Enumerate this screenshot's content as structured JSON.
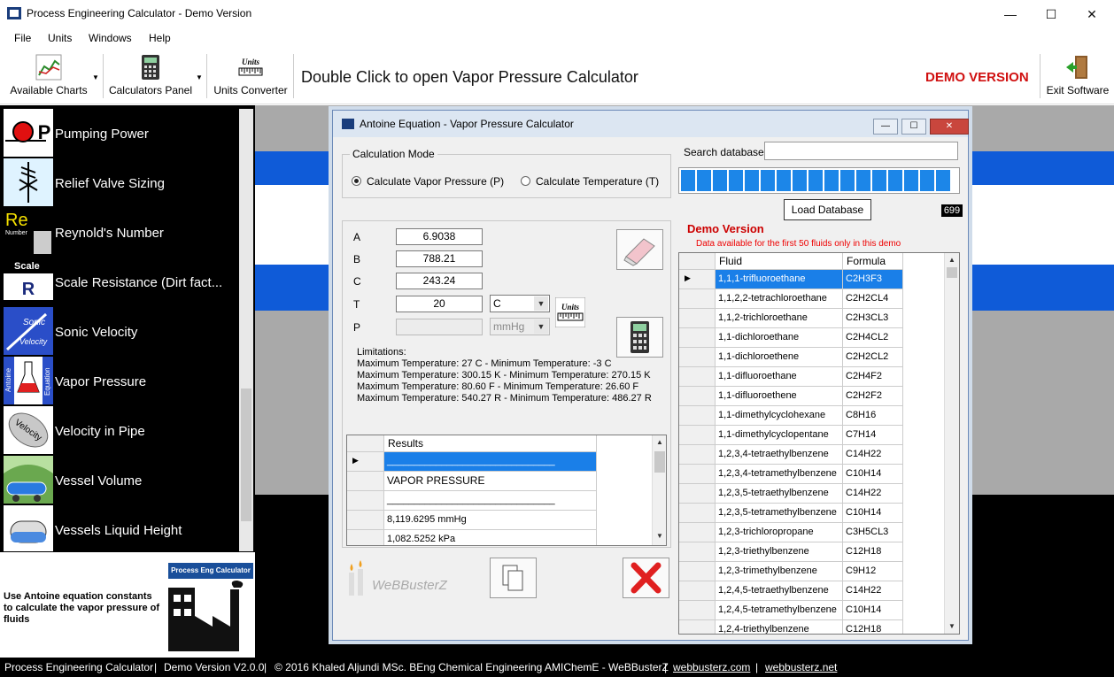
{
  "window": {
    "title": "Process Engineering Calculator - Demo Version",
    "minimize_glyph": "—",
    "maximize_glyph": "☐",
    "close_glyph": "✕"
  },
  "menu": [
    "File",
    "Units",
    "Windows",
    "Help"
  ],
  "toolbar": {
    "available_charts": "Available Charts",
    "calculators_panel": "Calculators Panel",
    "units_converter": "Units Converter",
    "units_icon_text": "Units",
    "hint": "Double Click to open Vapor Pressure Calculator",
    "demo": "DEMO VERSION",
    "exit": "Exit Software"
  },
  "sidebar": {
    "items": [
      {
        "label": "Pumping Power",
        "icon": "pump-icon",
        "thumb_text": "P"
      },
      {
        "label": "Relief Valve Sizing",
        "icon": "relief-valve-icon",
        "thumb_text": ""
      },
      {
        "label": "Reynold's Number",
        "icon": "reynolds-icon",
        "thumb_text": "Re",
        "thumb_sub": "Number"
      },
      {
        "label": "Scale Resistance (Dirt fact...",
        "icon": "scale-icon",
        "thumb_text": "Scale",
        "thumb_sub": "R"
      },
      {
        "label": "Sonic Velocity",
        "icon": "sonic-velocity-icon",
        "thumb_text": "Sonic",
        "thumb_sub": "Velocity"
      },
      {
        "label": "Vapor Pressure",
        "icon": "flask-icon",
        "thumb_text": "Antoine",
        "thumb_sub": "Equation"
      },
      {
        "label": "Velocity in Pipe",
        "icon": "velocity-icon",
        "thumb_text": "Velocity"
      },
      {
        "label": "Vessel Volume",
        "icon": "vessel-volume-icon",
        "thumb_text": ""
      },
      {
        "label": "Vessels Liquid Height",
        "icon": "vessel-height-icon",
        "thumb_text": ""
      }
    ],
    "description": "Use Antoine equation constants to calculate the vapor pressure of fluids",
    "logo_text": "Process Eng Calculator"
  },
  "dialog": {
    "title": "Antoine Equation - Vapor Pressure Calculator",
    "calc_mode": {
      "title": "Calculation Mode",
      "opt_p": "Calculate Vapor Pressure (P)",
      "opt_t": "Calculate Temperature (T)"
    },
    "inputs": {
      "a_label": "A",
      "a_value": "6.9038",
      "b_label": "B",
      "b_value": "788.21",
      "c_label": "C",
      "c_value": "243.24",
      "t_label": "T",
      "t_value": "20",
      "t_unit": "C",
      "p_label": "P",
      "p_value": "",
      "p_unit": "mmHg"
    },
    "limitations": [
      "Limitations:",
      "Maximum Temperature: 27 C - Minimum Temperature: -3 C",
      "Maximum Temperature: 300.15 K - Minimum Temperature: 270.15 K",
      "Maximum Temperature: 80.60 F - Minimum Temperature: 26.60 F",
      "Maximum Temperature: 540.27 R - Minimum Temperature: 486.27 R"
    ],
    "results": {
      "header": "Results",
      "rows": [
        "_______________________________",
        "VAPOR PRESSURE",
        "_______________________________",
        "8,119.6295 mmHg",
        "1,082.5252 kPa"
      ]
    },
    "brand": "WeBBusterZ",
    "search_label": "Search database",
    "load_db": "Load Database",
    "db_count": "699",
    "demo_version": "Demo Version",
    "demo_note": "Data available for the first 50 fluids only in this demo",
    "fluid_table": {
      "headers": [
        "Fluid",
        "Formula"
      ],
      "rows": [
        [
          "1,1,1-trifluoroethane",
          "C2H3F3"
        ],
        [
          "1,1,2,2-tetrachloroethane",
          "C2H2CL4"
        ],
        [
          "1,1,2-trichloroethane",
          "C2H3CL3"
        ],
        [
          "1,1-dichloroethane",
          "C2H4CL2"
        ],
        [
          "1,1-dichloroethene",
          "C2H2CL2"
        ],
        [
          "1,1-difluoroethane",
          "C2H4F2"
        ],
        [
          "1,1-difluoroethene",
          "C2H2F2"
        ],
        [
          "1,1-dimethylcyclohexane",
          "C8H16"
        ],
        [
          "1,1-dimethylcyclopentane",
          "C7H14"
        ],
        [
          "1,2,3,4-tetraethylbenzene",
          "C14H22"
        ],
        [
          "1,2,3,4-tetramethylbenzene",
          "C10H14"
        ],
        [
          "1,2,3,5-tetraethylbenzene",
          "C14H22"
        ],
        [
          "1,2,3,5-tetramethylbenzene",
          "C10H14"
        ],
        [
          "1,2,3-trichloropropane",
          "C3H5CL3"
        ],
        [
          "1,2,3-triethylbenzene",
          "C12H18"
        ],
        [
          "1,2,3-trimethylbenzene",
          "C9H12"
        ],
        [
          "1,2,4,5-tetraethylbenzene",
          "C14H22"
        ],
        [
          "1,2,4,5-tetramethylbenzene",
          "C10H14"
        ],
        [
          "1,2,4-triethylbenzene",
          "C12H18"
        ]
      ]
    }
  },
  "status": {
    "app": "Process Engineering Calculator",
    "version": "Demo Version V2.0.0",
    "copyright": "© 2016 Khaled Aljundi MSc. BEng Chemical Engineering AMIChemE - WeBBusterZ",
    "link1": "webbusterz.com",
    "link2": "webbusterz.net",
    "sep": "|"
  },
  "colors": {
    "accent_blue": "#1a7fe8",
    "demo_red": "#d01010",
    "bg_blue": "#0f5bd8"
  }
}
